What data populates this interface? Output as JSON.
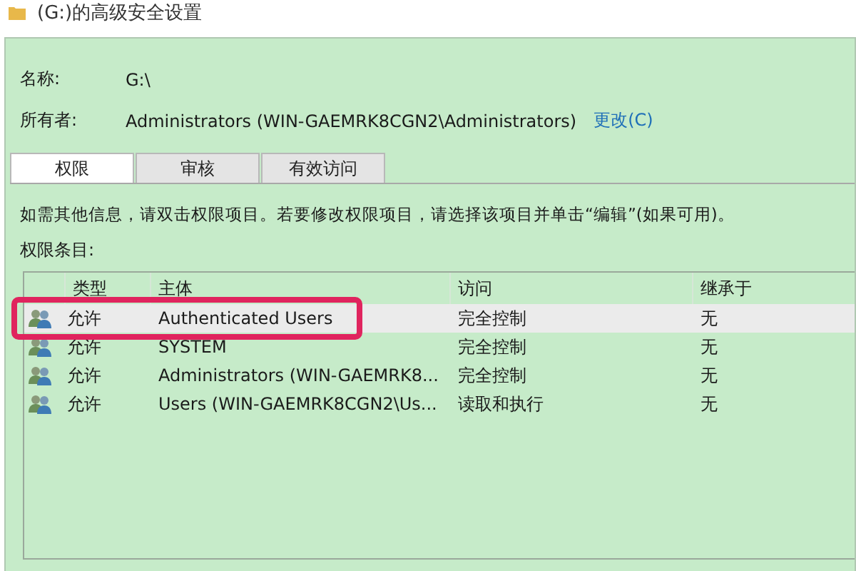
{
  "window": {
    "title": "(G:)的高级安全设置"
  },
  "fields": [
    {
      "label": "名称:",
      "value": "G:\\"
    },
    {
      "label": "所有者:",
      "value": "Administrators (WIN-GAEMRK8CGN2\\Administrators)",
      "link": "更改(C)"
    }
  ],
  "tabs": [
    {
      "label": "权限",
      "selected": true
    },
    {
      "label": "审核",
      "selected": false
    },
    {
      "label": "有效访问",
      "selected": false
    }
  ],
  "info": "如需其他信息，请双击权限项目。若要修改权限项目，请选择该项目并单击“编辑”(如果可用)。",
  "list_label": "权限条目:",
  "table": {
    "columns": [
      "类型",
      "主体",
      "访问",
      "继承于"
    ],
    "rows": [
      {
        "cells": [
          "允许",
          "Authenticated Users",
          "完全控制",
          "无"
        ],
        "selected": true,
        "highlighted": true
      },
      {
        "cells": [
          "允许",
          "SYSTEM",
          "完全控制",
          "无"
        ],
        "selected": false,
        "highlighted": false
      },
      {
        "cells": [
          "允许",
          "Administrators (WIN-GAEMRK8...",
          "完全控制",
          "无"
        ],
        "selected": false,
        "highlighted": false
      },
      {
        "cells": [
          "允许",
          "Users (WIN-GAEMRK8CGN2\\Us...",
          "读取和执行",
          "无"
        ],
        "selected": false,
        "highlighted": false
      }
    ]
  }
}
